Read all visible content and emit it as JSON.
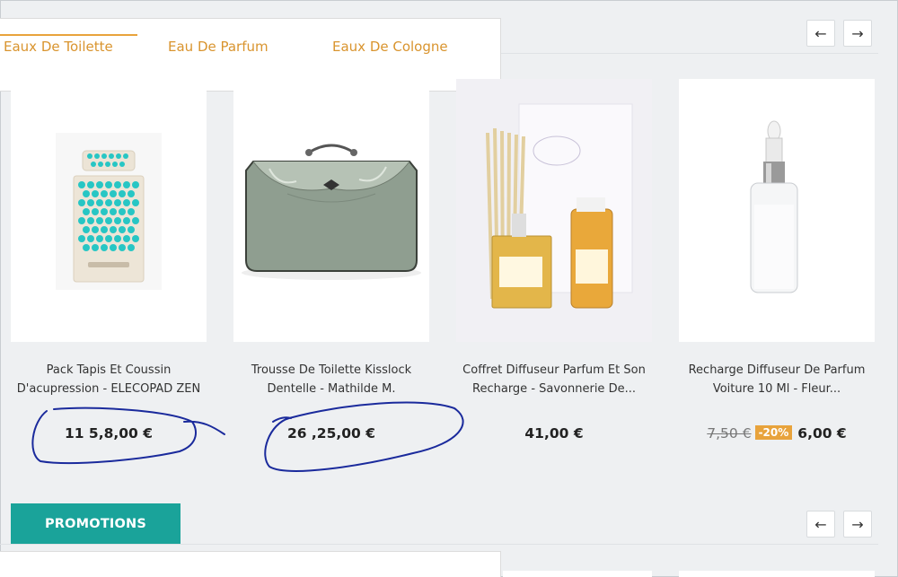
{
  "tabs": [
    {
      "label": "Eaux De Toilette"
    },
    {
      "label": "Eau De Parfum"
    },
    {
      "label": "Eaux De Cologne"
    }
  ],
  "nav": {
    "prev_icon": "arrow-left-icon",
    "prev_glyph": "←",
    "next_icon": "arrow-right-icon",
    "next_glyph": "→"
  },
  "products": [
    {
      "name_line1": "Pack Tapis Et Coussin",
      "name_line2": "D'acupression - ELECOPAD ZEN",
      "price": "11 5,8,00 €"
    },
    {
      "name_line1": "Trousse De Toilette Kisslock",
      "name_line2": "Dentelle - Mathilde M.",
      "price": "26 ,25,00 €"
    },
    {
      "name_line1": "Coffret Diffuseur Parfum Et Son",
      "name_line2": "Recharge - Savonnerie De...",
      "price": "41,00 €"
    },
    {
      "name_line1": "Recharge Diffuseur De Parfum",
      "name_line2": "Voiture 10 Ml - Fleur...",
      "old_price": "7,50 €",
      "discount": "-20%",
      "price": "6,00 €"
    }
  ],
  "promotions": {
    "label": "PROMOTIONS"
  },
  "colors": {
    "accent": "#e8a33c",
    "teal": "#1aa39a",
    "ink": "#1a2a9c"
  }
}
